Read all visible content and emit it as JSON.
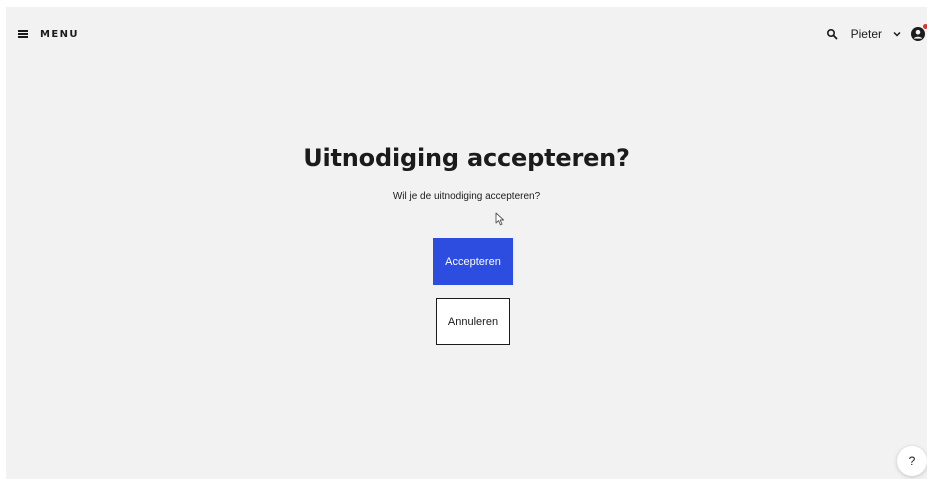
{
  "header": {
    "menu_label": "MENU",
    "user_name": "Pieter",
    "icons": {
      "menu": "hamburger-icon",
      "search": "search-icon",
      "dropdown": "chevron-down-icon",
      "account": "account-icon"
    },
    "notification_dot_color": "#e0312b"
  },
  "main": {
    "title": "Uitnodiging accepteren?",
    "subtitle": "Wil je de uitnodiging accepteren?",
    "accept_label": "Accepteren",
    "cancel_label": "Annuleren"
  },
  "help": {
    "label": "?"
  },
  "colors": {
    "background": "#f2f2f2",
    "primary": "#2c4de0",
    "text": "#1b1b1b"
  }
}
